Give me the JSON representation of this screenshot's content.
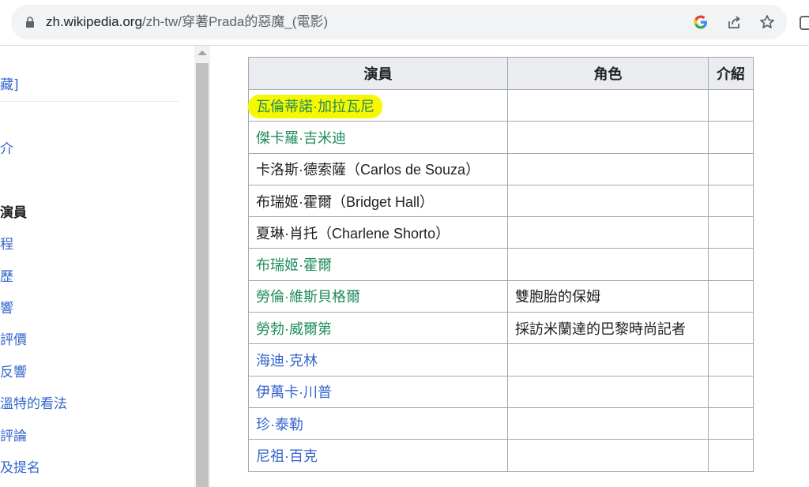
{
  "browser": {
    "url_host": "zh.wikipedia.org",
    "url_path": "/zh-tw/穿著Prada的惡魔_(電影)"
  },
  "sidebar": {
    "items": [
      {
        "label": "藏]",
        "bold": false
      },
      {
        "label": "介",
        "bold": false
      },
      {
        "label": "演員",
        "bold": true
      },
      {
        "label": "程",
        "bold": false
      },
      {
        "label": "歷",
        "bold": false
      },
      {
        "label": "響",
        "bold": false
      },
      {
        "label": "評價",
        "bold": false
      },
      {
        "label": "反響",
        "bold": false
      },
      {
        "label": "溫特的看法",
        "bold": false
      },
      {
        "label": "評論",
        "bold": false
      },
      {
        "label": "及提名",
        "bold": false
      }
    ]
  },
  "table": {
    "headers": [
      "演員",
      "角色",
      "介紹"
    ],
    "rows": [
      {
        "actor": "瓦倫蒂諾·加拉瓦尼",
        "role": "",
        "intro": "",
        "link": true,
        "visited": true,
        "highlighted": true
      },
      {
        "actor": "傑卡羅·吉米迪",
        "role": "",
        "intro": "",
        "link": true,
        "visited": true,
        "highlighted": false
      },
      {
        "actor": "卡洛斯·德索薩（Carlos de Souza）",
        "role": "",
        "intro": "",
        "link": false,
        "visited": false,
        "highlighted": false
      },
      {
        "actor": "布瑞姬·霍爾（Bridget Hall）",
        "role": "",
        "intro": "",
        "link": false,
        "visited": false,
        "highlighted": false
      },
      {
        "actor": "夏琳·肖托（Charlene Shorto）",
        "role": "",
        "intro": "",
        "link": false,
        "visited": false,
        "highlighted": false
      },
      {
        "actor": "布瑞姬·霍爾",
        "role": "",
        "intro": "",
        "link": true,
        "visited": true,
        "highlighted": false
      },
      {
        "actor": "勞倫·維斯貝格爾",
        "role": "雙胞胎的保姆",
        "intro": "",
        "link": true,
        "visited": true,
        "highlighted": false
      },
      {
        "actor": "勞勃·威爾第",
        "role": "採訪米蘭達的巴黎時尚記者",
        "intro": "",
        "link": true,
        "visited": true,
        "highlighted": false
      },
      {
        "actor": "海迪·克林",
        "role": "",
        "intro": "",
        "link": true,
        "visited": false,
        "highlighted": false
      },
      {
        "actor": "伊萬卡·川普",
        "role": "",
        "intro": "",
        "link": true,
        "visited": false,
        "highlighted": false
      },
      {
        "actor": "珍·泰勒",
        "role": "",
        "intro": "",
        "link": true,
        "visited": false,
        "highlighted": false
      },
      {
        "actor": "尼祖·百克",
        "role": "",
        "intro": "",
        "link": true,
        "visited": false,
        "highlighted": false
      }
    ]
  },
  "colors": {
    "link": "#3366cc",
    "visited_link": "#1e8b5e",
    "highlight": "#f7f700"
  }
}
